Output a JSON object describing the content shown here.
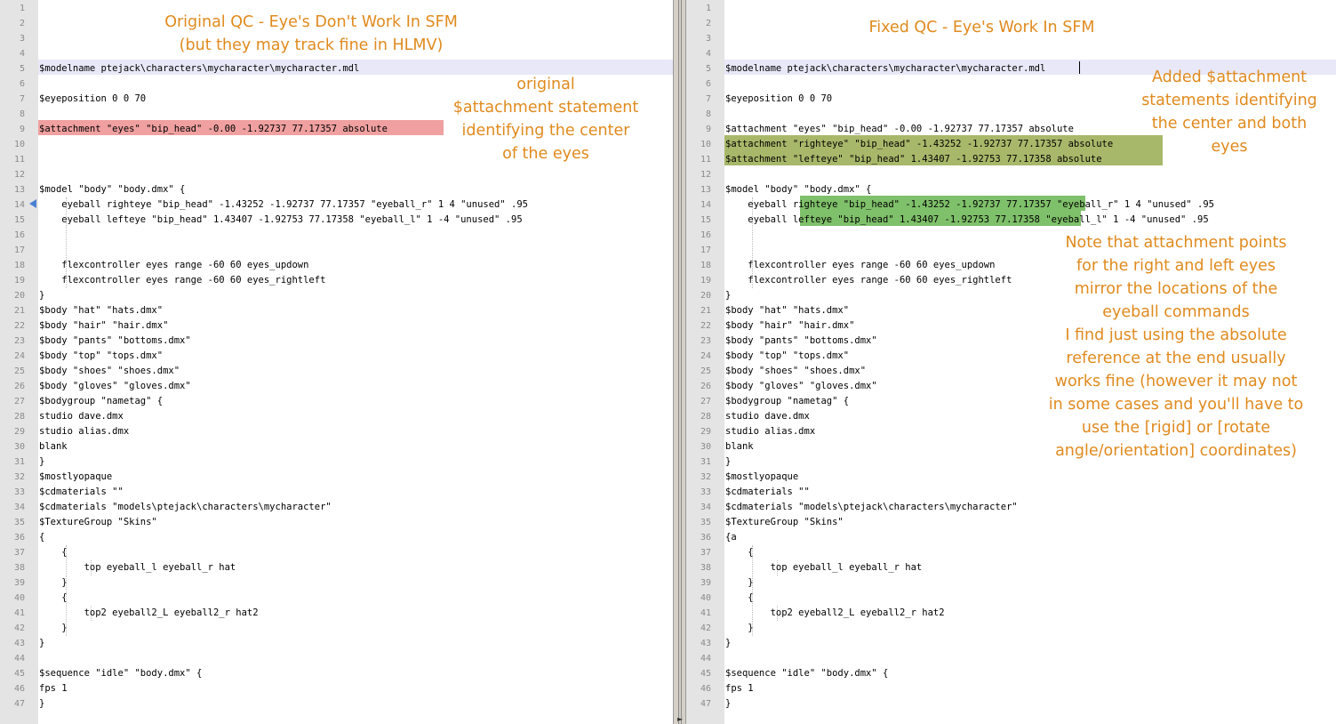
{
  "left_pane": {
    "caption_title": "Original QC - Eye's Don't Work In SFM\n(but they may track fine in HLMV)",
    "caption_note": "original\n$attachment statement\nidentifying the center\nof the eyes",
    "lines": [
      "",
      "",
      "",
      "",
      "$modelname ptejack\\characters\\mycharacter\\mycharacter.mdl",
      "",
      "$eyeposition 0 0 70",
      "",
      "$attachment \"eyes\" \"bip_head\" -0.00 -1.92737 77.17357 absolute",
      "",
      "",
      "",
      "$model \"body\" \"body.dmx\" {",
      "    eyeball righteye \"bip_head\" -1.43252 -1.92737 77.17357 \"eyeball_r\" 1 4 \"unused\" .95",
      "    eyeball lefteye \"bip_head\" 1.43407 -1.92753 77.17358 \"eyeball_l\" 1 -4 \"unused\" .95",
      "",
      "",
      "    flexcontroller eyes range -60 60 eyes_updown",
      "    flexcontroller eyes range -60 60 eyes_rightleft",
      "}",
      "$body \"hat\" \"hats.dmx\"",
      "$body \"hair\" \"hair.dmx\"",
      "$body \"pants\" \"bottoms.dmx\"",
      "$body \"top\" \"tops.dmx\"",
      "$body \"shoes\" \"shoes.dmx\"",
      "$body \"gloves\" \"gloves.dmx\"",
      "$bodygroup \"nametag\" {",
      "studio dave.dmx",
      "studio alias.dmx",
      "blank",
      "}",
      "$mostlyopaque",
      "$cdmaterials \"\"",
      "$cdmaterials \"models\\ptejack\\characters\\mycharacter\"",
      "$TextureGroup \"Skins\"",
      "{",
      "    {",
      "        top eyeball_l eyeball_r hat",
      "    }",
      "    {",
      "        top2 eyeball2_L eyeball2_r hat2",
      "    }",
      "}",
      "",
      "$sequence \"idle\" \"body.dmx\" {",
      "fps 1",
      "}"
    ]
  },
  "right_pane": {
    "caption_title": "Fixed QC - Eye's Work In SFM",
    "caption_added": "Added $attachment\nstatements identifying\nthe center and both\neyes",
    "caption_note": "Note that attachment points\nfor the right and left eyes\nmirror the locations of the\neyeball commands\nI find just using the absolute\nreference at the end usually\nworks fine (however it may not\nin some cases and you'll have to\nuse the [rigid] or [rotate\nangle/orientation] coordinates)",
    "lines": [
      "",
      "",
      "",
      "",
      "$modelname ptejack\\characters\\mycharacter\\mycharacter.mdl",
      "",
      "$eyeposition 0 0 70",
      "",
      "$attachment \"eyes\" \"bip_head\" -0.00 -1.92737 77.17357 absolute",
      "$attachment \"righteye\" \"bip_head\" -1.43252 -1.92737 77.17357 absolute",
      "$attachment \"lefteye\" \"bip_head\" 1.43407 -1.92753 77.17358 absolute",
      "",
      "$model \"body\" \"body.dmx\" {",
      "    eyeball righteye \"bip_head\" -1.43252 -1.92737 77.17357 \"eyeball_r\" 1 4 \"unused\" .95",
      "    eyeball lefteye \"bip_head\" 1.43407 -1.92753 77.17358 \"eyeball_l\" 1 -4 \"unused\" .95",
      "",
      "",
      "    flexcontroller eyes range -60 60 eyes_updown",
      "    flexcontroller eyes range -60 60 eyes_rightleft",
      "}",
      "$body \"hat\" \"hats.dmx\"",
      "$body \"hair\" \"hair.dmx\"",
      "$body \"pants\" \"bottoms.dmx\"",
      "$body \"top\" \"tops.dmx\"",
      "$body \"shoes\" \"shoes.dmx\"",
      "$body \"gloves\" \"gloves.dmx\"",
      "$bodygroup \"nametag\" {",
      "studio dave.dmx",
      "studio alias.dmx",
      "blank",
      "}",
      "$mostlyopaque",
      "$cdmaterials \"\"",
      "$cdmaterials \"models\\ptejack\\characters\\mycharacter\"",
      "$TextureGroup \"Skins\"",
      "{a",
      "    {",
      "        top eyeball_l eyeball_r hat",
      "    }",
      "    {",
      "        top2 eyeball2_L eyeball2_r hat2",
      "    }",
      "}",
      "",
      "$sequence \"idle\" \"body.dmx\" {",
      "fps 1",
      "}"
    ]
  },
  "colors": {
    "annotation": "#e08a1e",
    "removed_highlight": "#f0a0a0",
    "added_highlight": "#a8b86a",
    "changed_highlight": "#7fc06a",
    "current_line": "#e8e8f8"
  },
  "icons": {
    "bookmark": "bookmark-arrow-icon",
    "corner": "corner-arrow-icon"
  }
}
